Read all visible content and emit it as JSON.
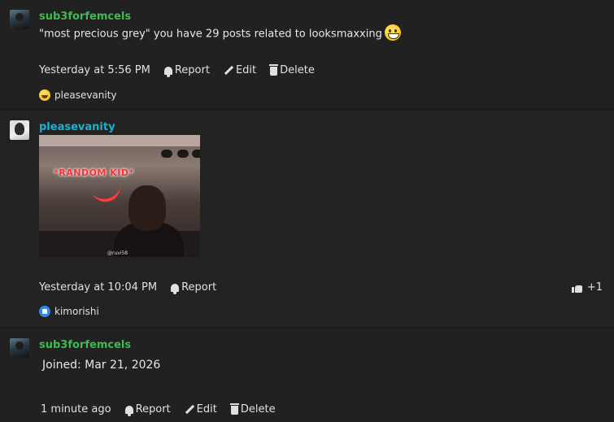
{
  "posts": [
    {
      "username": "sub3forfemcels",
      "content": "\"most precious grey\" you have 29 posts related to looksmaxxing",
      "content_emoji": "grinning-face-emoji",
      "timestamp": "Yesterday at 5:56 PM",
      "actions": {
        "report": "Report",
        "edit": "Edit",
        "delete": "Delete"
      },
      "reaction": {
        "icon": "laughing-emoji",
        "user": "pleasevanity"
      }
    },
    {
      "username": "pleasevanity",
      "gif": {
        "caption": "*RANDOM KID*",
        "credit": "@ruvi58"
      },
      "timestamp": "Yesterday at 10:04 PM",
      "actions": {
        "report": "Report"
      },
      "likes": "+1",
      "reaction": {
        "icon": "like-emoji",
        "user": "kimorishi"
      }
    },
    {
      "username": "sub3forfemcels",
      "content": "Joined: Mar 21, 2026",
      "timestamp": "1 minute ago",
      "actions": {
        "report": "Report",
        "edit": "Edit",
        "delete": "Delete"
      }
    }
  ],
  "colors": {
    "background": "#212121",
    "username_green": "#3dbb52",
    "username_cyan": "#18b3cf",
    "text": "#e6e6e6"
  }
}
